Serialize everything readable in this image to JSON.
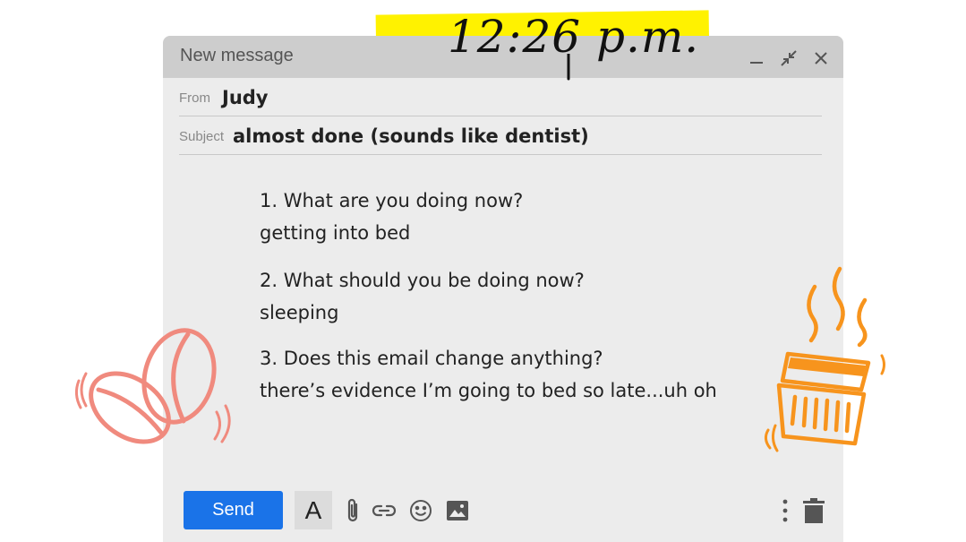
{
  "window": {
    "title": "New message",
    "controls": [
      "minimize-icon",
      "collapse-icon",
      "close-icon"
    ]
  },
  "timestamp": "12:26 p.m.",
  "from": {
    "label": "From",
    "value": "Judy"
  },
  "subject": {
    "label": "Subject",
    "value": "almost done (sounds like dentist)"
  },
  "body": {
    "items": [
      {
        "question": "1. What are you doing now?",
        "answer": "getting into bed"
      },
      {
        "question": "2. What should you be doing now?",
        "answer": "sleeping"
      },
      {
        "question": "3. Does this email change anything?",
        "answer": "there’s evidence I’m going to bed so late...uh oh"
      }
    ]
  },
  "toolbar": {
    "send_label": "Send",
    "format_label": "A",
    "icons": [
      "attach-icon",
      "link-icon",
      "emoji-icon",
      "image-icon",
      "more-icon",
      "trash-icon"
    ]
  },
  "colors": {
    "send": "#1a73e8",
    "highlight": "#fff200",
    "coffee_bean": "#f08a7e",
    "cup": "#f7941d"
  }
}
